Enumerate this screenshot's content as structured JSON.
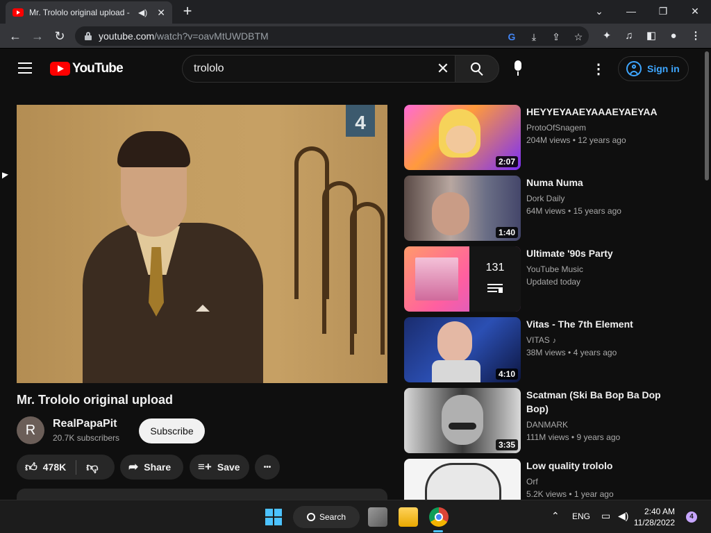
{
  "browser": {
    "tab": {
      "title": "Mr. Trololo original upload -",
      "audio_icon": "speaker-icon",
      "close_glyph": "✕"
    },
    "new_tab_glyph": "+",
    "url_host": "youtube.com",
    "url_path": "/watch?v=oavMtUWDBTM",
    "window_controls": {
      "chevron": "⌄",
      "minimize": "—",
      "restore": "❐",
      "close": "✕"
    }
  },
  "youtube": {
    "logo_text": "YouTube",
    "search_query": "trololo",
    "signin_label": "Sign in",
    "colors": {
      "brand_red": "#ff0000",
      "link_blue": "#3ea6ff",
      "bg": "#0f0f0f"
    }
  },
  "video": {
    "title": "Mr. Trololo original upload",
    "channel": {
      "avatar_letter": "R",
      "name": "RealPapaPit",
      "subscribers": "20.7K subscribers"
    },
    "subscribe_label": "Subscribe",
    "likes": "478K",
    "share_label": "Share",
    "save_label": "Save",
    "more_glyph": "•••",
    "player_sign": "4"
  },
  "related": [
    {
      "title": "HEYYEYAAEYAAAEYAEYAA",
      "channel": "ProtoOfSnagem",
      "views": "204M views",
      "age": "12 years ago",
      "duration": "2:07"
    },
    {
      "title": "Numa Numa",
      "channel": "Dork Daily",
      "views": "64M views",
      "age": "15 years ago",
      "duration": "1:40"
    },
    {
      "title": "Ultimate '90s Party",
      "channel": "YouTube Music",
      "meta": "Updated today",
      "playlist_count": "131"
    },
    {
      "title": "Vitas - The 7th Element",
      "channel": "VITAS",
      "views": "38M views",
      "age": "4 years ago",
      "duration": "4:10"
    },
    {
      "title": "Scatman (Ski Ba Bop Ba Dop Bop)",
      "channel": "DANMARK",
      "views": "111M views",
      "age": "9 years ago",
      "duration": "3:35"
    },
    {
      "title": "Low quality trololo",
      "channel": "Orf",
      "views": "5.2K views",
      "age": "1 year ago"
    }
  ],
  "taskbar": {
    "search_label": "Search",
    "lang": "ENG",
    "time": "2:40 AM",
    "date": "11/28/2022",
    "notification_count": "4"
  }
}
